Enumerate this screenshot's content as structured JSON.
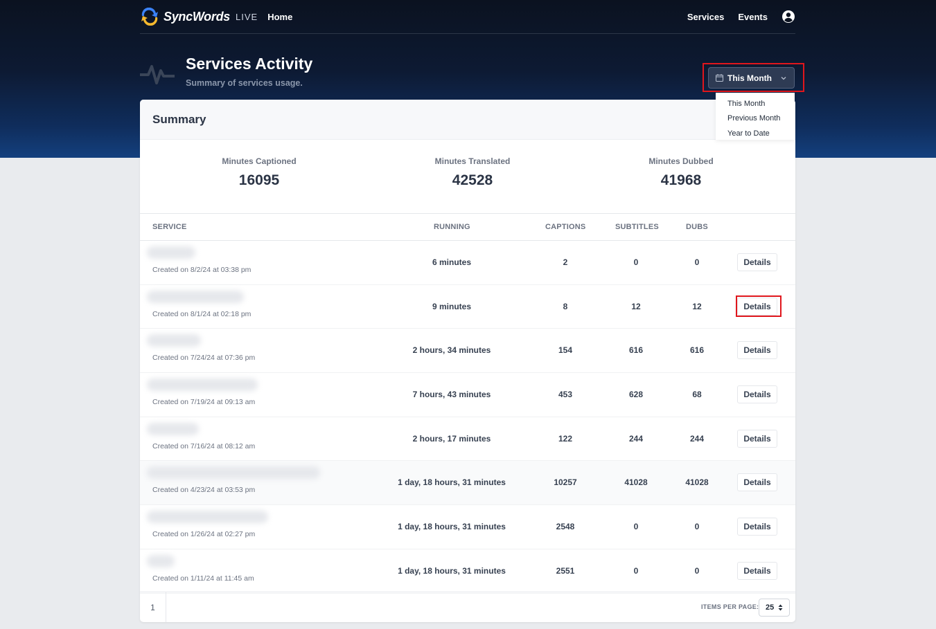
{
  "nav": {
    "brand": "SyncWords",
    "brand_suffix": "LIVE",
    "home": "Home",
    "services": "Services",
    "events": "Events"
  },
  "page": {
    "title": "Services Activity",
    "subtitle": "Summary of services usage."
  },
  "range": {
    "selected": "This Month",
    "options": [
      "This Month",
      "Previous Month",
      "Year to Date"
    ]
  },
  "summary": {
    "title": "Summary",
    "stats": [
      {
        "label": "Minutes Captioned",
        "value": "16095"
      },
      {
        "label": "Minutes Translated",
        "value": "42528"
      },
      {
        "label": "Minutes Dubbed",
        "value": "41968"
      }
    ]
  },
  "table": {
    "columns": {
      "service": "SERVICE",
      "running": "RUNNING",
      "captions": "CAPTIONS",
      "subtitles": "SUBTITLES",
      "dubs": "DUBS"
    },
    "details_label": "Details",
    "rows": [
      {
        "created": "Created on 8/2/24 at 03:38 pm",
        "running": "6 minutes",
        "captions": "2",
        "subtitles": "0",
        "dubs": "0"
      },
      {
        "created": "Created on 8/1/24 at 02:18 pm",
        "running": "9 minutes",
        "captions": "8",
        "subtitles": "12",
        "dubs": "12"
      },
      {
        "created": "Created on 7/24/24 at 07:36 pm",
        "running": "2 hours, 34 minutes",
        "captions": "154",
        "subtitles": "616",
        "dubs": "616"
      },
      {
        "created": "Created on 7/19/24 at 09:13 am",
        "running": "7 hours, 43 minutes",
        "captions": "453",
        "subtitles": "628",
        "dubs": "68"
      },
      {
        "created": "Created on 7/16/24 at 08:12 am",
        "running": "2 hours, 17 minutes",
        "captions": "122",
        "subtitles": "244",
        "dubs": "244"
      },
      {
        "created": "Created on 4/23/24 at 03:53 pm",
        "running": "1 day, 18 hours, 31 minutes",
        "captions": "10257",
        "subtitles": "41028",
        "dubs": "41028"
      },
      {
        "created": "Created on 1/26/24 at 02:27 pm",
        "running": "1 day, 18 hours, 31 minutes",
        "captions": "2548",
        "subtitles": "0",
        "dubs": "0"
      },
      {
        "created": "Created on 1/11/24 at 11:45 am",
        "running": "1 day, 18 hours, 31 minutes",
        "captions": "2551",
        "subtitles": "0",
        "dubs": "0"
      }
    ]
  },
  "pagination": {
    "page": "1",
    "items_per_page_label": "ITEMS PER PAGE:",
    "items_per_page": "25"
  },
  "icons": [
    "logo-icon",
    "user-icon",
    "pulse-icon",
    "calendar-icon",
    "chevron-down-icon",
    "sort-icon"
  ],
  "colors": {
    "highlight": "#e0161c",
    "header_dark": "#0b1220",
    "header_blue": "#14407e"
  }
}
